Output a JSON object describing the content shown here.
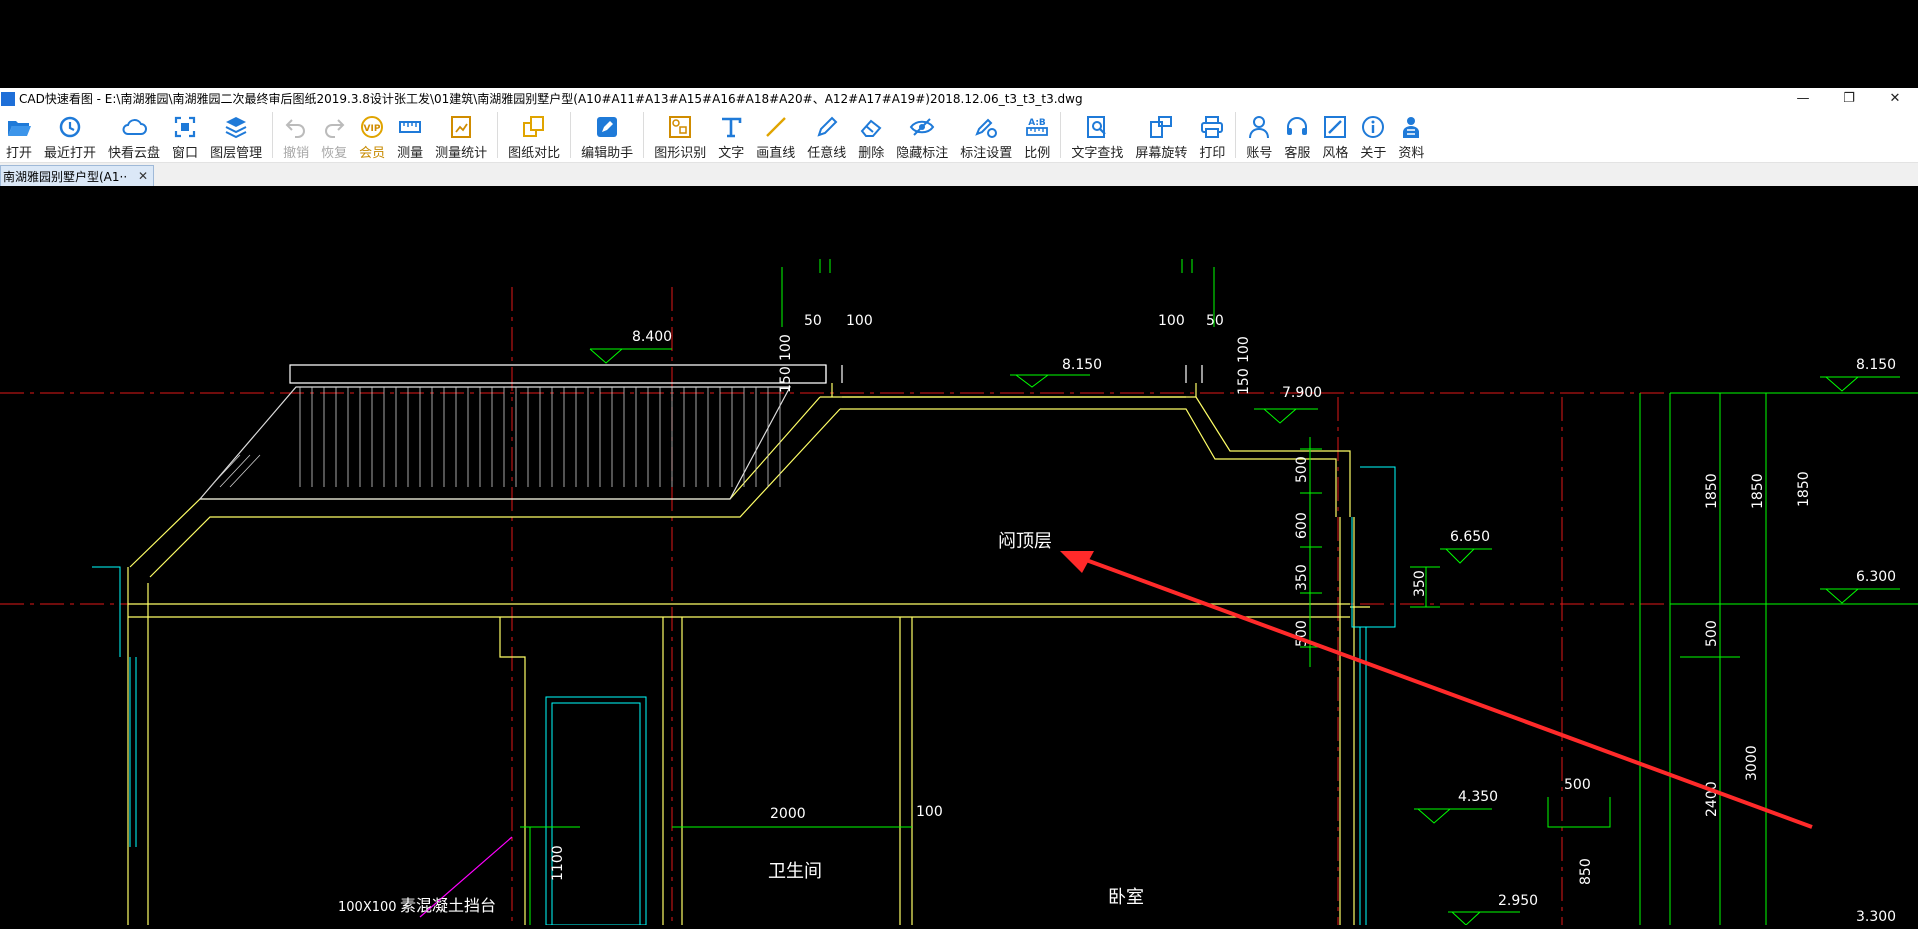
{
  "window": {
    "title": "CAD快速看图 - E:\\南湖雅园\\南湖雅园二次最终审后图纸2019.3.8设计张工发\\01建筑\\南湖雅园别墅户型(A10#A11#A13#A15#A16#A18#A20#、A12#A17#A19#)2018.12.06_t3_t3_t3.dwg",
    "minimize": "—",
    "restore": "❐",
    "close": "✕"
  },
  "toolbar": {
    "open": "打开",
    "recent": "最近打开",
    "cloud": "快看云盘",
    "window": "窗口",
    "layers": "图层管理",
    "undo": "撤销",
    "redo": "恢复",
    "vip": "会员",
    "measure": "测量",
    "measure_stats": "测量统计",
    "compare": "图纸对比",
    "edit_assist": "编辑助手",
    "shape_recog": "图形识别",
    "text": "文字",
    "draw_line": "画直线",
    "freehand": "任意线",
    "delete": "删除",
    "hide_marks": "隐藏标注",
    "mark_settings": "标注设置",
    "scale": "比例",
    "find_text": "文字查找",
    "rotate": "屏幕旋转",
    "print": "打印",
    "account": "账号",
    "service": "客服",
    "style": "风格",
    "about": "关于",
    "resources": "资料",
    "scale_icon_text": "A:B"
  },
  "tab": {
    "label": "南湖雅园别墅户型(A1··",
    "close": "✕"
  },
  "drawing": {
    "elevations": [
      "8.400",
      "8.150",
      "7.900",
      "8.150",
      "6.650",
      "6.300",
      "4.350",
      "2.950",
      "3.300"
    ],
    "dims_top": [
      "50",
      "100",
      "100",
      "50"
    ],
    "dims_side": [
      "100",
      "150",
      "100",
      "150"
    ],
    "dims_v": [
      "500",
      "600",
      "350",
      "350",
      "500",
      "1850",
      "1850",
      "1850",
      "500",
      "3000",
      "2400",
      "850",
      "1100"
    ],
    "dims_h": [
      "2000",
      "100",
      "500"
    ],
    "labels": {
      "attic": "闷顶层",
      "bathroom": "卫生间",
      "bedroom": "卧室",
      "concrete": "素混凝土挡台",
      "size": "100X100"
    },
    "colors": {
      "wall": "#ffff66",
      "axis": "#ff2222",
      "dim": "#00ff00",
      "annot": "#ff2a2a",
      "cyan": "#00ffff",
      "magenta": "#ff00ff"
    }
  }
}
